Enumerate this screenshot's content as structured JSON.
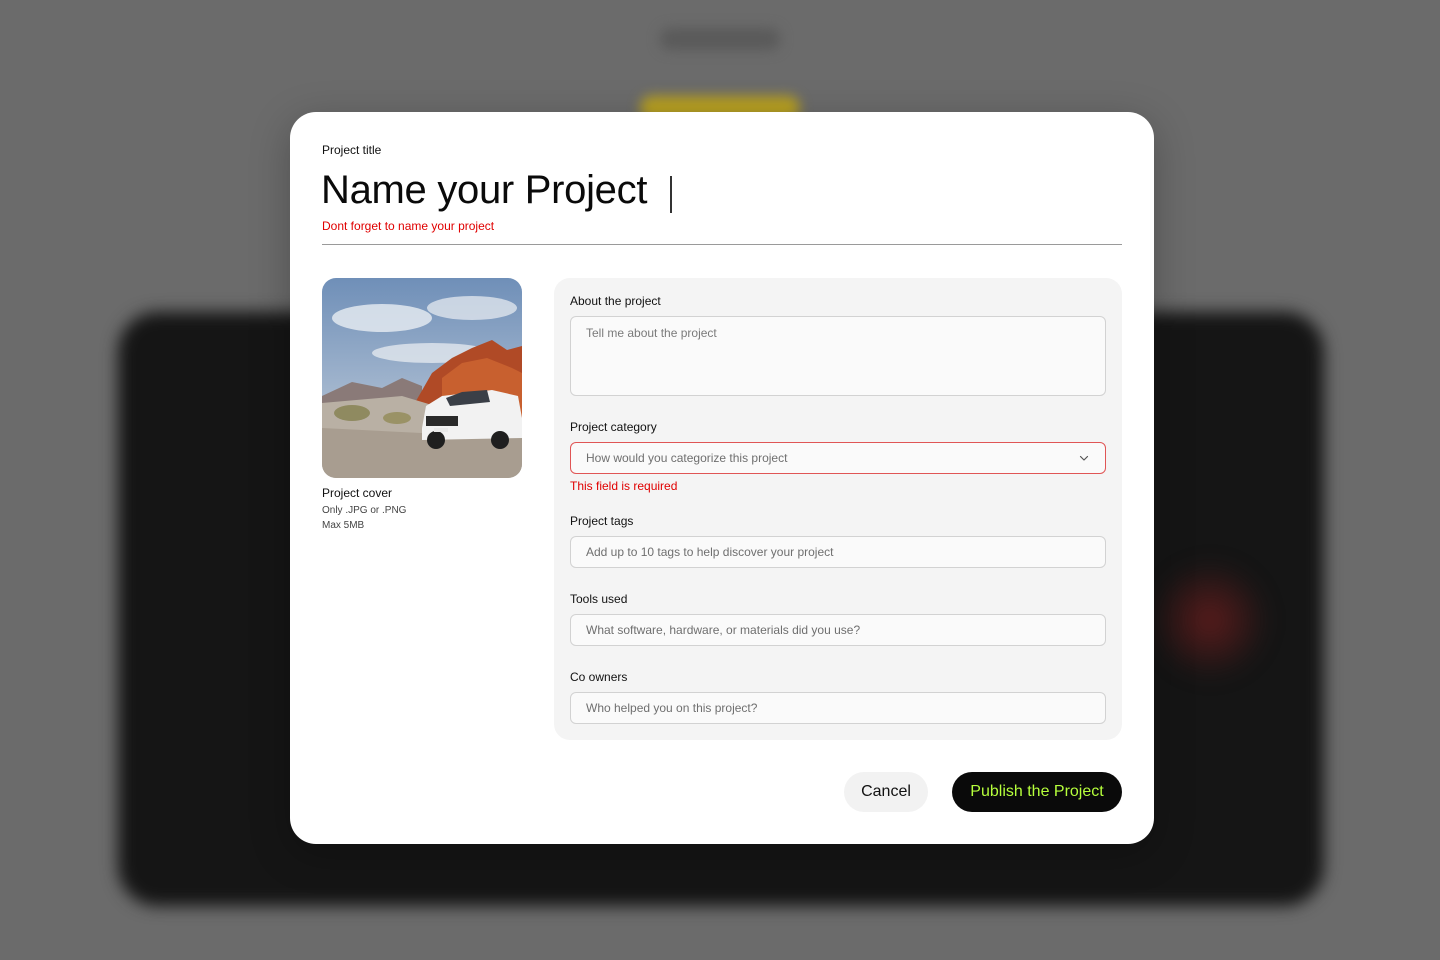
{
  "modal": {
    "title_label": "Project title",
    "title_value": "Name your Project",
    "title_error": "Dont forget to name your project"
  },
  "cover": {
    "label": "Project cover",
    "hint_format": "Only .JPG or .PNG",
    "hint_size": "Max 5MB"
  },
  "form": {
    "about": {
      "label": "About the project",
      "placeholder": "Tell me about the project"
    },
    "category": {
      "label": "Project category",
      "placeholder": "How would you categorize this project",
      "error": "This field is required",
      "icon": "chevron-down-icon"
    },
    "tags": {
      "label": "Project tags",
      "placeholder": "Add up to 10 tags to help discover your project"
    },
    "tools": {
      "label": "Tools used",
      "placeholder": "What software, hardware, or materials did you use?"
    },
    "co_owners": {
      "label": "Co owners",
      "placeholder": "Who helped you on this project?"
    }
  },
  "actions": {
    "cancel_label": "Cancel",
    "publish_label": "Publish the Project"
  },
  "colors": {
    "error": "#e00000",
    "publish_text": "#b6ff3c",
    "publish_bg": "#0a0a0a"
  }
}
